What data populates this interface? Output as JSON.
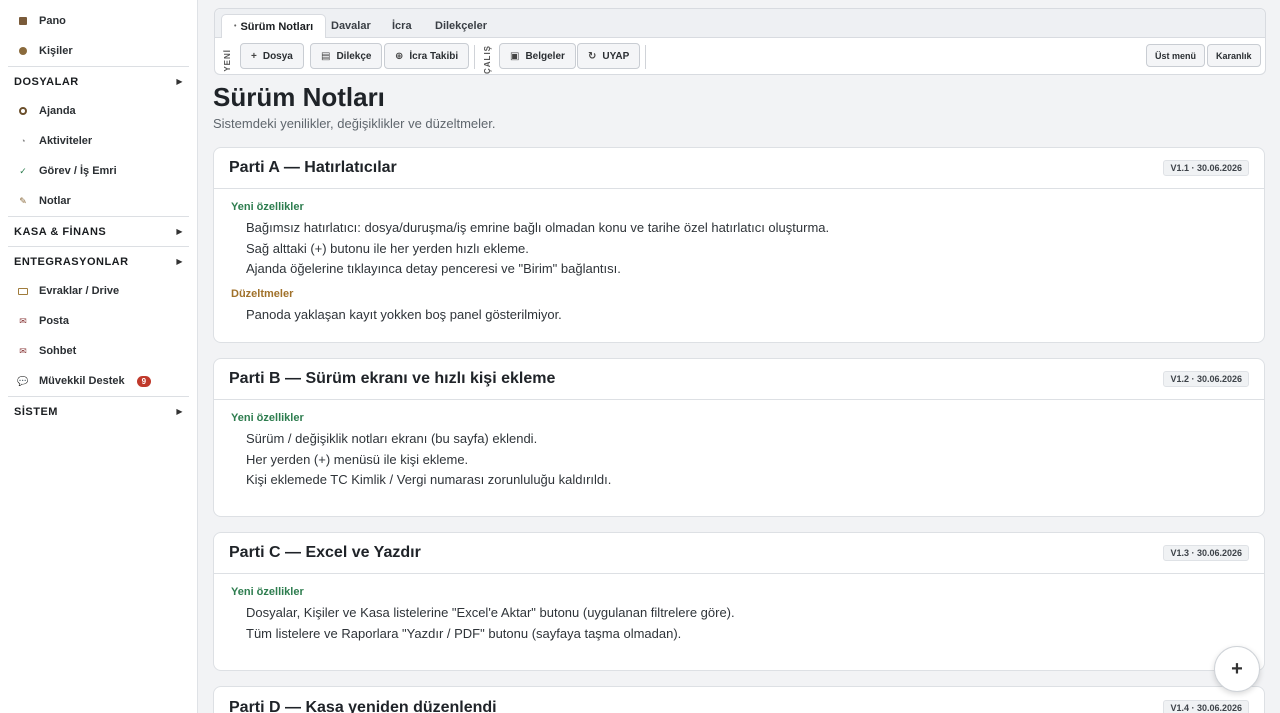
{
  "sidebar": {
    "top_items": [
      {
        "label": "Pano",
        "icon": "dashboard-icon"
      },
      {
        "label": "Kişiler",
        "icon": "contacts-icon"
      }
    ],
    "sections": [
      {
        "label": "DOSYALAR",
        "items": [
          {
            "label": "Ajanda",
            "icon": "calendar-icon"
          },
          {
            "label": "Aktiviteler",
            "icon": "activity-icon"
          },
          {
            "label": "Görev / İş Emri",
            "icon": "check-icon"
          },
          {
            "label": "Notlar",
            "icon": "pencil-icon"
          }
        ]
      },
      {
        "label": "KASA & FİNANS",
        "items": []
      },
      {
        "label": "ENTEGRASYONLAR",
        "items": [
          {
            "label": "Evraklar / Drive",
            "icon": "folder-icon"
          },
          {
            "label": "Posta",
            "icon": "mail-icon"
          },
          {
            "label": "Sohbet",
            "icon": "chat-icon"
          },
          {
            "label": "Müvekkil Destek",
            "icon": "support-icon",
            "badge": "9"
          }
        ]
      },
      {
        "label": "SİSTEM",
        "items": []
      }
    ]
  },
  "toolbar": {
    "tabs": [
      "Sürüm Notları",
      "Davalar",
      "İcra",
      "Dilekçeler"
    ],
    "label_yeni": "YENİ",
    "label_calis": "ÇALIŞ",
    "buttons": [
      "Dosya",
      "Dilekçe",
      "İcra Takibi",
      "Belgeler",
      "UYAP"
    ],
    "right_buttons": [
      "Üst menü",
      "Karanlık"
    ]
  },
  "page": {
    "title": "Sürüm Notları",
    "subtitle": "Sistemdeki yenilikler, değişiklikler ve düzeltmeler."
  },
  "cards": [
    {
      "title": "Parti A — Hatırlatıcılar",
      "version": "V1.1 · 30.06.2026",
      "new_label": "Yeni özellikler",
      "new_items": [
        "Bağımsız hatırlatıcı: dosya/duruşma/iş emrine bağlı olmadan konu ve tarihe özel hatırlatıcı oluşturma.",
        "Sağ alttaki (+) butonu ile her yerden hızlı ekleme.",
        "Ajanda öğelerine tıklayınca detay penceresi ve \"Birim\" bağlantısı."
      ],
      "fix_label": "Düzeltmeler",
      "fix_items": [
        "Panoda yaklaşan kayıt yokken boş panel gösterilmiyor."
      ]
    },
    {
      "title": "Parti B — Sürüm ekranı ve hızlı kişi ekleme",
      "version": "V1.2 · 30.06.2026",
      "new_label": "Yeni özellikler",
      "new_items": [
        "Sürüm / değişiklik notları ekranı (bu sayfa) eklendi.",
        "Her yerden (+) menüsü ile kişi ekleme.",
        "Kişi eklemede TC Kimlik / Vergi numarası zorunluluğu kaldırıldı."
      ]
    },
    {
      "title": "Parti C — Excel ve Yazdır",
      "version": "V1.3 · 30.06.2026",
      "new_label": "Yeni özellikler",
      "new_items": [
        "Dosyalar, Kişiler ve Kasa listelerine \"Excel'e Aktar\" butonu (uygulanan filtrelere göre).",
        "Tüm listelere ve Raporlara \"Yazdır / PDF\" butonu (sayfaya taşma olmadan)."
      ]
    },
    {
      "title": "Parti D — Kasa yeniden düzenlendi",
      "version": "V1.4 · 30.06.2026"
    }
  ],
  "fab": "+"
}
